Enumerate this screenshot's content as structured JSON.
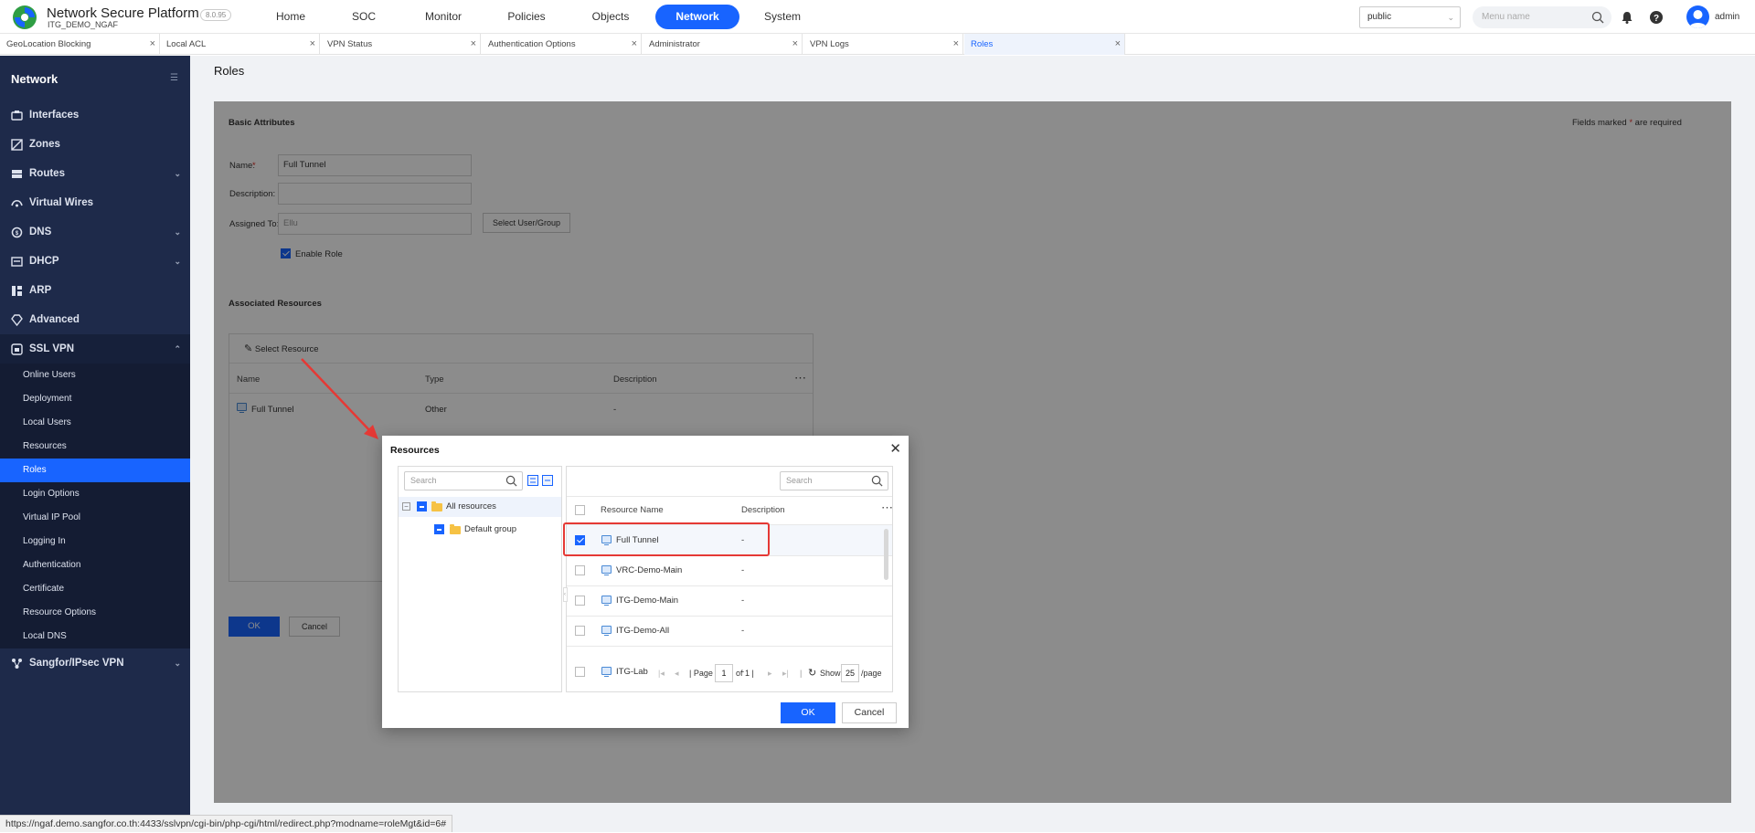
{
  "app": {
    "title": "Network Secure Platform",
    "device": "ITG_DEMO_NGAF",
    "version": "8.0.95",
    "logo_icon": "sangfor-logo-icon"
  },
  "nav": {
    "items": [
      "Home",
      "SOC",
      "Monitor",
      "Policies",
      "Objects",
      "Network",
      "System"
    ],
    "active": "Network"
  },
  "toolbar": {
    "zone": "public",
    "menu_search_placeholder": "Menu name",
    "user": "admin",
    "icons": [
      "search-icon",
      "bell-icon",
      "help-icon",
      "avatar-icon"
    ]
  },
  "tabs": {
    "items": [
      "GeoLocation Blocking",
      "Local ACL",
      "VPN Status",
      "Authentication Options",
      "Administrator",
      "VPN Logs",
      "Roles"
    ],
    "active": "Roles",
    "close_glyph": "×"
  },
  "sidebar": {
    "title": "Network",
    "items": [
      "Interfaces",
      "Zones",
      "Routes",
      "Virtual Wires",
      "DNS",
      "DHCP",
      "ARP",
      "Advanced",
      "SSL VPN"
    ],
    "ssl_vpn_children": [
      "Online Users",
      "Deployment",
      "Local Users",
      "Resources",
      "Roles",
      "Login Options",
      "Virtual IP Pool",
      "Logging In",
      "Authentication",
      "Certificate",
      "Resource Options",
      "Local DNS"
    ],
    "active_child": "Roles",
    "last_item": "Sangfor/IPsec VPN"
  },
  "page": {
    "title": "Roles",
    "basic_attributes": "Basic Attributes",
    "required_note_prefix": "Fields marked ",
    "required_star": "*",
    "required_note_suffix": " are required",
    "name_label": "Name:",
    "name_value": "Full Tunnel",
    "description_label": "Description:",
    "description_value": "",
    "assigned_label": "Assigned To:",
    "assigned_value": "Ellu",
    "select_user_button": "Select User/Group",
    "enable_role_label": "Enable Role",
    "enable_role_checked": true,
    "associated_resources": "Associated Resources",
    "select_resource": "Select Resource",
    "table_headers": [
      "Name",
      "Type",
      "Description"
    ],
    "rows": [
      {
        "name": "Full Tunnel",
        "type": "Other",
        "description": "-"
      }
    ],
    "ok": "OK",
    "cancel": "Cancel"
  },
  "modal": {
    "title": "Resources",
    "tree_search_placeholder": "Search",
    "tree": [
      {
        "label": "All resources",
        "level": 0
      },
      {
        "label": "Default group",
        "level": 1
      }
    ],
    "list_search_placeholder": "Search",
    "headers": [
      "Resource Name",
      "Description"
    ],
    "rows": [
      {
        "name": "Full Tunnel",
        "description": "-",
        "checked": true
      },
      {
        "name": "VRC-Demo-Main",
        "description": "-",
        "checked": false
      },
      {
        "name": "ITG-Demo-Main",
        "description": "-",
        "checked": false
      },
      {
        "name": "ITG-Demo-All",
        "description": "-",
        "checked": false
      },
      {
        "name": "ITG-Lab",
        "description": "-",
        "checked": false
      }
    ],
    "pager": {
      "page_label": "Page",
      "page": "1",
      "of_label": "of 1",
      "show_label": "Show",
      "per_page": "25",
      "per_page_suffix": "/page"
    },
    "ok": "OK",
    "cancel": "Cancel"
  },
  "status_url": "https://ngaf.demo.sangfor.co.th:4433/sslvpn/cgi-bin/php-cgi/html/redirect.php?modname=roleMgt&id=6#",
  "colors": {
    "accent": "#1864ff",
    "sidebar": "#1e2a4a",
    "annotation": "#e53935"
  }
}
